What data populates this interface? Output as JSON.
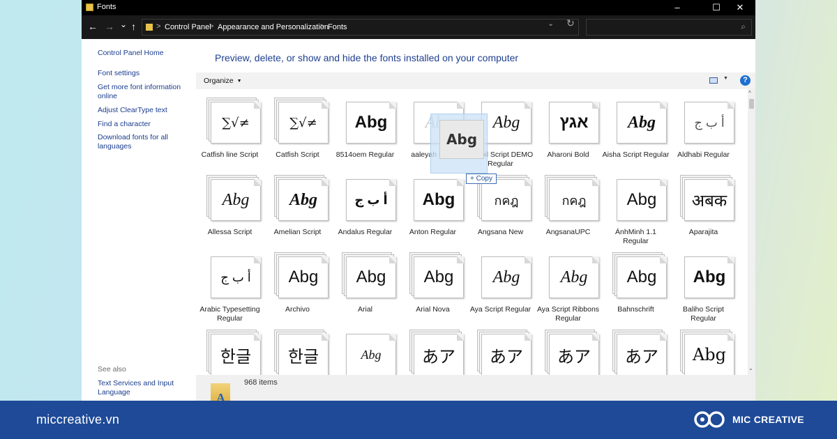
{
  "window": {
    "title": "Fonts",
    "controls": {
      "minimize": "–",
      "maximize": "☐",
      "close": "✕"
    }
  },
  "address": {
    "back": "←",
    "forward": "→",
    "recent": "⌄",
    "up": "↑",
    "breadcrumbs": [
      "Control Panel",
      "Appearance and Personalization",
      "Fonts"
    ],
    "separator": ">",
    "dropdown": "⌄",
    "refresh": "↻",
    "search_icon": "⌕",
    "search_placeholder": ""
  },
  "left_pane": {
    "links": [
      "Control Panel Home",
      "Font settings",
      "Get more font information online",
      "Adjust ClearType text",
      "Find a character",
      "Download fonts for all languages"
    ],
    "see_also_label": "See also",
    "see_also_links": [
      "Text Services and Input Language"
    ]
  },
  "main": {
    "heading": "Preview, delete, or show and hide the fonts installed on your computer",
    "organize_label": "Organize",
    "organize_caret": "▼",
    "view_caret": "▼",
    "help_label": "?",
    "scroll_up": "^",
    "scroll_down": "⌄"
  },
  "fonts": [
    {
      "name": "Catfish line Script",
      "sample": "∑√≠",
      "style": "s-serif s-small",
      "stack": 3
    },
    {
      "name": "Catfish Script",
      "sample": "∑√≠",
      "style": "s-serif s-small",
      "stack": 3
    },
    {
      "name": "8514oem Regular",
      "sample": "Abg",
      "style": "s-bold",
      "stack": 1
    },
    {
      "name": "aaleyah Light",
      "sample": "Abg",
      "style": "s-ghost",
      "stack": 1
    },
    {
      "name": "Ababil Script DEMO Regular",
      "sample": "Abg",
      "style": "s-italic",
      "stack": 1
    },
    {
      "name": "Aharoni Bold",
      "sample": "אגץ",
      "style": "s-bold",
      "stack": 1
    },
    {
      "name": "Aisha Script Regular",
      "sample": "Abg",
      "style": "s-italic s-bold",
      "stack": 1
    },
    {
      "name": "Aldhabi Regular",
      "sample": "أ ب ج",
      "style": "s-small s-light",
      "stack": 1
    },
    {
      "name": "Allessa Script",
      "sample": "Abg",
      "style": "s-italic",
      "stack": 3
    },
    {
      "name": "Amelian Script",
      "sample": "Abg",
      "style": "s-italic s-bold",
      "stack": 3
    },
    {
      "name": "Andalus Regular",
      "sample": "أ ب ج",
      "style": "s-small s-bold",
      "stack": 1
    },
    {
      "name": "Anton Regular",
      "sample": "Abg",
      "style": "s-bold",
      "stack": 1
    },
    {
      "name": "Angsana New",
      "sample": "กคฎ",
      "style": "s-small",
      "stack": 3
    },
    {
      "name": "AngsanaUPC",
      "sample": "กคฎ",
      "style": "s-small",
      "stack": 3
    },
    {
      "name": "ÁnhMinh 1.1 Regular",
      "sample": "Abg",
      "style": "",
      "stack": 1
    },
    {
      "name": "Aparajita",
      "sample": "अबक",
      "style": "",
      "stack": 3
    },
    {
      "name": "Arabic Typesetting Regular",
      "sample": "أ ب ج",
      "style": "s-small",
      "stack": 1
    },
    {
      "name": "Archivo",
      "sample": "Abg",
      "style": "",
      "stack": 3
    },
    {
      "name": "Arial",
      "sample": "Abg",
      "style": "",
      "stack": 3
    },
    {
      "name": "Arial Nova",
      "sample": "Abg",
      "style": "",
      "stack": 3
    },
    {
      "name": "Aya Script Regular",
      "sample": "Abg",
      "style": "s-italic",
      "stack": 1
    },
    {
      "name": "Aya Script Ribbons Regular",
      "sample": "Abg",
      "style": "s-italic",
      "stack": 1
    },
    {
      "name": "Bahnschrift",
      "sample": "Abg",
      "style": "",
      "stack": 3
    },
    {
      "name": "Baliho Script Regular",
      "sample": "Abg",
      "style": "s-bold",
      "stack": 1
    },
    {
      "name": "",
      "sample": "한글",
      "style": "",
      "stack": 3
    },
    {
      "name": "",
      "sample": "한글",
      "style": "",
      "stack": 3
    },
    {
      "name": "",
      "sample": "Abg",
      "style": "s-italic s-small",
      "stack": 1
    },
    {
      "name": "",
      "sample": "あア",
      "style": "",
      "stack": 3
    },
    {
      "name": "",
      "sample": "あア",
      "style": "",
      "stack": 3
    },
    {
      "name": "",
      "sample": "あア",
      "style": "",
      "stack": 3
    },
    {
      "name": "",
      "sample": "あア",
      "style": "",
      "stack": 3
    },
    {
      "name": "",
      "sample": "Abg",
      "style": "s-serif",
      "stack": 3
    }
  ],
  "drag": {
    "sample": "Abg",
    "copy_label": "+ Copy"
  },
  "status": {
    "icon_letter": "A",
    "item_count": "968 items"
  },
  "footer": {
    "site": "miccreative.vn",
    "brand": "MIC CREATIVE"
  },
  "colors": {
    "link": "#1a3c8c",
    "heading": "#1e3f8f",
    "footer_bg": "#1e4a98",
    "titlebar_bg": "#000000"
  }
}
